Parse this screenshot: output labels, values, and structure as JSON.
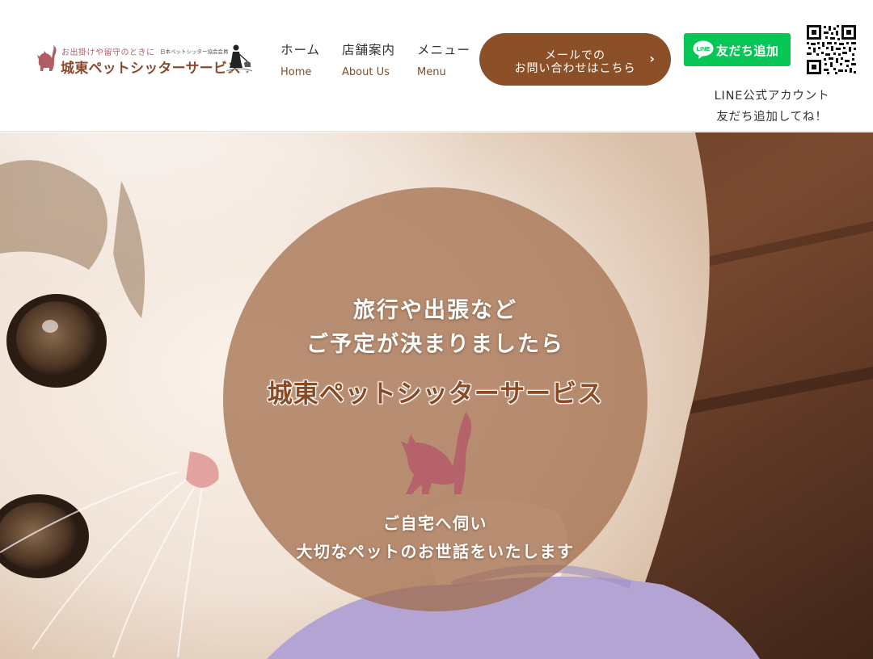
{
  "logo": {
    "tagline": "お出掛けや留守のときに",
    "association": "日本ペットシッター協会会員",
    "name": "城東ペットシッターサービス"
  },
  "nav": [
    {
      "ja": "ホーム",
      "en": "Home"
    },
    {
      "ja": "店舗案内",
      "en": "About Us"
    },
    {
      "ja": "メニュー",
      "en": "Menu"
    }
  ],
  "contact": {
    "line1": "メールでの",
    "line2": "お問い合わせはこちら",
    "arrow": "›"
  },
  "line": {
    "button_label": "友だち追加",
    "icon_text": "LINE",
    "caption_line1": "LINE公式アカウント",
    "caption_line2": "友だち追加してね！"
  },
  "hero": {
    "line1": "旅行や出張など",
    "line2": "ご予定が決まりましたら",
    "brand": "城東ペットシッターサービス",
    "line3": "ご自宅へ伺い",
    "line4": "大切なペットのお世話をいたします"
  },
  "colors": {
    "brand_brown": "#8b5027",
    "line_green": "#06c755",
    "circle_overlay": "#a06946",
    "cat_silhouette": "#b5626a"
  }
}
